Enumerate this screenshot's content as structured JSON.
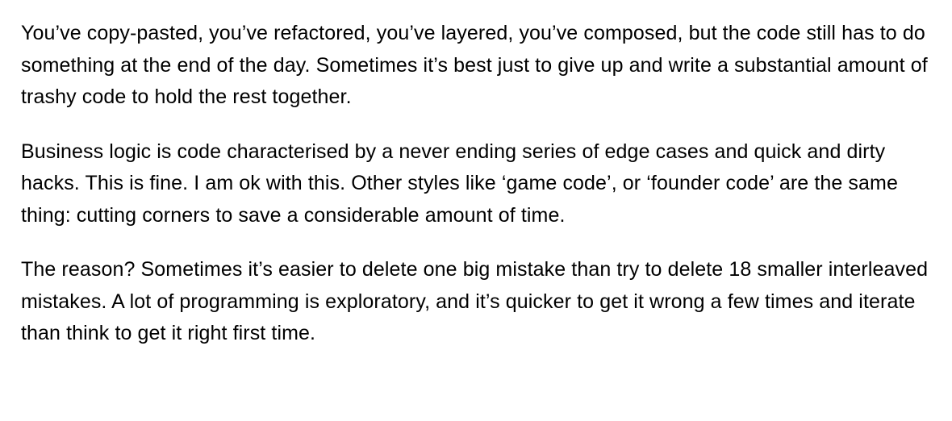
{
  "paragraphs": [
    "You’ve copy-pasted, you’ve refactored, you’ve layered, you’ve composed, but the code still has to do something at the end of the day. Sometimes it’s best just to give up and write a substantial amount of trashy code to hold the rest together.",
    "Business logic is code characterised by a never ending series of edge cases and quick and dirty hacks. This is fine. I am ok with this. Other styles like ‘game code’, or ‘founder code’ are the same thing: cutting corners to save a considerable amount of time.",
    "The reason? Sometimes it’s easier to delete one big mistake than try to delete 18 smaller interleaved mistakes. A lot of programming is exploratory, and it’s quicker to get it wrong a few times and iterate than think to get it right first time."
  ]
}
